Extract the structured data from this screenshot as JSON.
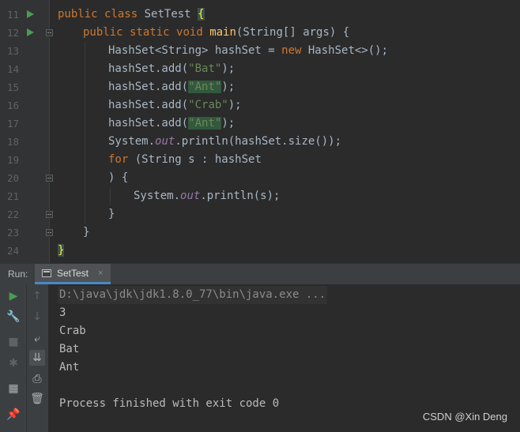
{
  "editor": {
    "line_numbers": [
      "11",
      "12",
      "13",
      "14",
      "15",
      "16",
      "17",
      "18",
      "19",
      "20",
      "21",
      "22",
      "23",
      "24"
    ],
    "code": {
      "l11": {
        "kw1": "public",
        "kw2": "class",
        "name": "SetTest",
        "brace": "{"
      },
      "l12": {
        "kw1": "public",
        "kw2": "static",
        "kw3": "void",
        "fn": "main",
        "rest": "(String[] args) {"
      },
      "l13": {
        "pre": "HashSet<String> hashSet = ",
        "kw": "new",
        "post": " HashSet<>();"
      },
      "l14": {
        "pre": "hashSet.add(",
        "str": "\"Bat\"",
        "post": ");"
      },
      "l15": {
        "pre": "hashSet.add(",
        "str": "\"Ant\"",
        "post": ");"
      },
      "l16": {
        "pre": "hashSet.add(",
        "str": "\"Crab\"",
        "post": ");"
      },
      "l17": {
        "pre": "hashSet.add(",
        "str": "\"Ant\"",
        "post": ");"
      },
      "l18": {
        "pre": "System.",
        "it": "out",
        "post": ".println(hashSet.size());"
      },
      "l19": {
        "kw": "for",
        "post": " (String s : hashSet"
      },
      "l20": {
        "text": ") {"
      },
      "l21": {
        "pre": "System.",
        "it": "out",
        "post": ".println(s);"
      },
      "l22": {
        "text": "}"
      },
      "l23": {
        "text": "}"
      },
      "l24": {
        "brace": "}"
      }
    }
  },
  "run_panel": {
    "label": "Run:",
    "tab": {
      "label": "SetTest",
      "close": "×"
    },
    "tools_left": [
      "run-icon",
      "wrench-icon",
      "stop-icon",
      "debug-icon",
      "layout-icon",
      "pin-icon"
    ],
    "tools_right": [
      "up-arrow-icon",
      "down-arrow-icon",
      "soft-wrap-icon",
      "scroll-to-end-icon",
      "print-icon",
      "trash-icon"
    ]
  },
  "console": {
    "command": "D:\\java\\jdk\\jdk1.8.0_77\\bin\\java.exe ...",
    "output": [
      "3",
      "Crab",
      "Bat",
      "Ant"
    ],
    "exit_message": "Process finished with exit code 0"
  },
  "watermark": "CSDN @Xin Deng",
  "colors": {
    "background": "#2b2b2b",
    "gutter": "#313335",
    "keyword": "#cc7832",
    "function": "#ffc66d",
    "string": "#6a8759",
    "static_field": "#9876aa",
    "text": "#a9b7c6",
    "run_green": "#499c54",
    "tab_accent": "#4a88c7"
  }
}
